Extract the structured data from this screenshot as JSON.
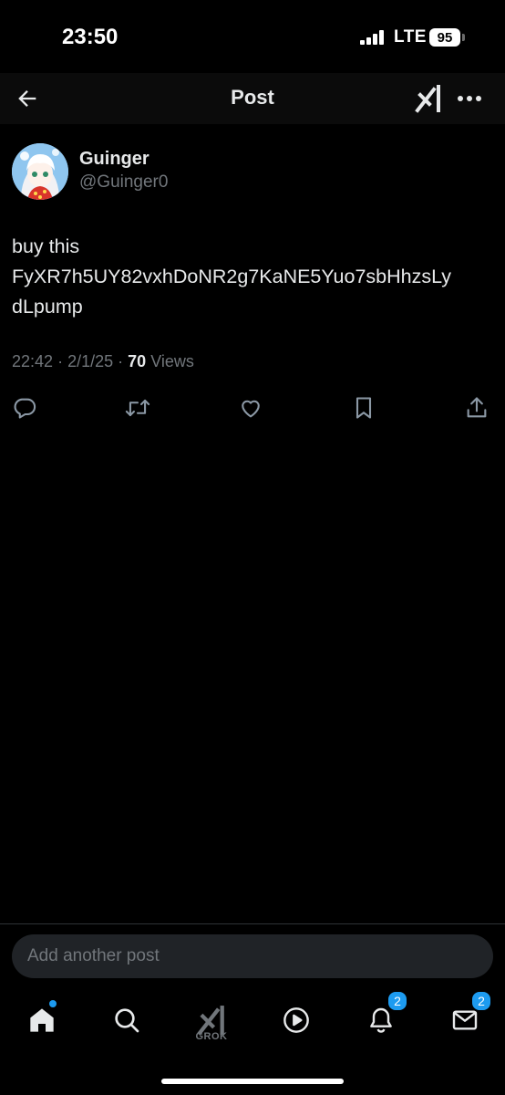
{
  "status_bar": {
    "time": "23:50",
    "network": "LTE",
    "battery": "95"
  },
  "header": {
    "title": "Post",
    "back_icon": "arrow-left-icon",
    "grok_icon": "grok-icon",
    "more_icon": "more-horizontal-icon"
  },
  "post": {
    "author_name": "Guinger",
    "author_handle": "@Guinger0",
    "text_lines": [
      "buy this",
      "FyXR7h5UY82vxhDoNR2g7KaNE5Yuo7sbHhzsLy",
      "dLpump"
    ],
    "time": "22:42",
    "date": "2/1/25",
    "views_count": "70",
    "views_label": "Views",
    "separator": "·"
  },
  "actions": [
    "reply-icon",
    "repost-icon",
    "like-icon",
    "bookmark-icon",
    "share-icon"
  ],
  "composer": {
    "placeholder": "Add another post"
  },
  "tab_bar": {
    "grok_label": "GROK",
    "notifications_badge": "2",
    "messages_badge": "2"
  },
  "colors": {
    "accent": "#1d9bf0",
    "background": "#000000",
    "secondary_text": "#71767b"
  }
}
